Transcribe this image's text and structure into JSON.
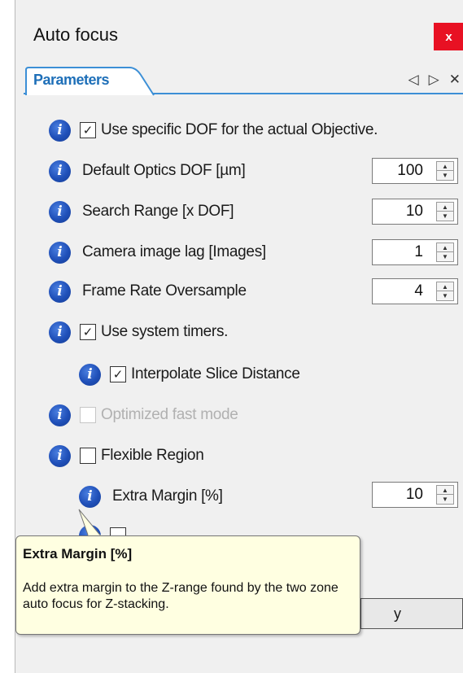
{
  "window": {
    "title": "Auto focus",
    "close_label": "x",
    "close_color": "#e81123"
  },
  "tab": {
    "label": "Parameters",
    "accent_color": "#3c8fd6"
  },
  "tab_controls": {
    "prev": "◁",
    "next": "▷",
    "close": "✕"
  },
  "params": {
    "use_specific_dof": {
      "label": "Use specific DOF for the actual Objective.",
      "checked": "✓"
    },
    "default_optics_dof": {
      "label": "Default Optics DOF [µm]",
      "value": "100"
    },
    "search_range": {
      "label": "Search Range [x DOF]",
      "value": "10"
    },
    "camera_image_lag": {
      "label": "Camera image lag [Images]",
      "value": "1"
    },
    "frame_rate_oversample": {
      "label": "Frame Rate Oversample",
      "value": "4"
    },
    "use_system_timers": {
      "label": "Use system timers.",
      "checked": "✓"
    },
    "interpolate_slice_distance": {
      "label": "Interpolate Slice Distance",
      "checked": "✓"
    },
    "optimized_fast_mode": {
      "label": "Optimized fast mode",
      "checked": ""
    },
    "flexible_region": {
      "label": "Flexible Region",
      "checked": ""
    },
    "extra_margin": {
      "label": "Extra Margin [%]",
      "value": "10"
    }
  },
  "info_glyph": "i",
  "tooltip": {
    "title": "Extra Margin [%]",
    "text": "Add extra margin to the Z-range found by the two zone auto focus for Z-stacking."
  },
  "partial_button_label": "y"
}
